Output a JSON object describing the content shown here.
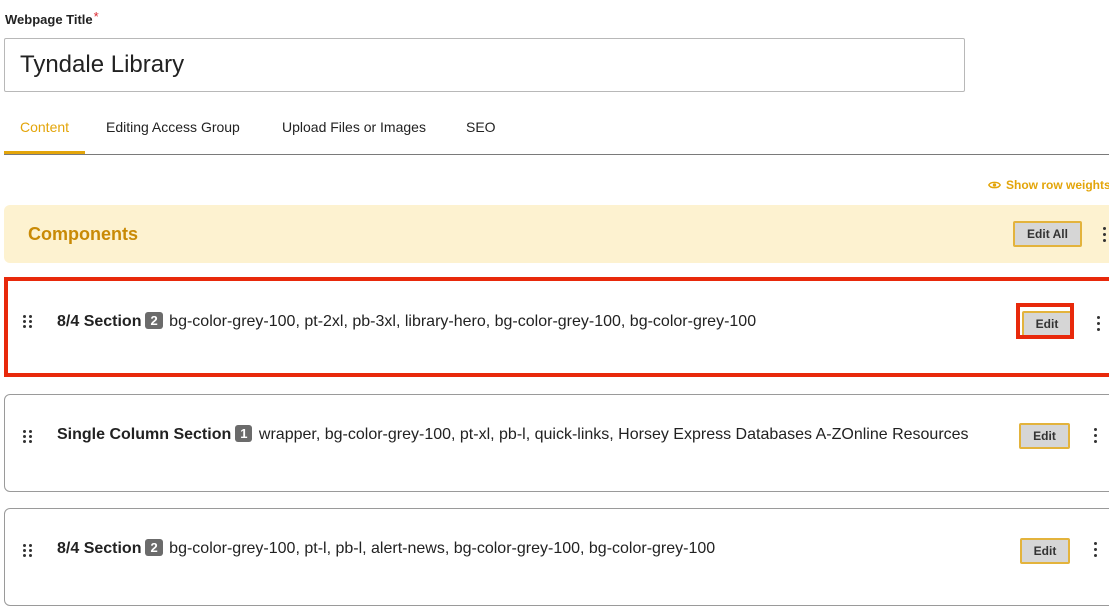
{
  "form": {
    "title_label": "Webpage Title",
    "required_mark": "*",
    "title_value": "Tyndale Library"
  },
  "tabs": [
    {
      "label": "Content",
      "active": true
    },
    {
      "label": "Editing Access Group",
      "active": false
    },
    {
      "label": "Upload Files or Images",
      "active": false
    },
    {
      "label": "SEO",
      "active": false
    }
  ],
  "row_weights": {
    "label": "Show row weights",
    "icon": "eye-icon"
  },
  "components": {
    "title": "Components",
    "edit_all_label": "Edit All"
  },
  "sections": [
    {
      "name": "8/4 Section",
      "count": "2",
      "classes": "bg-color-grey-100, pt-2xl, pb-3xl, library-hero, bg-color-grey-100, bg-color-grey-100",
      "edit_label": "Edit",
      "highlighted": true
    },
    {
      "name": "Single Column Section",
      "count": "1",
      "classes": "wrapper, bg-color-grey-100, pt-xl, pb-l, quick-links, Horsey Express Databases A-ZOnline Resources",
      "edit_label": "Edit",
      "highlighted": false
    },
    {
      "name": "8/4 Section",
      "count": "2",
      "classes": "bg-color-grey-100, pt-l, pb-l, alert-news, bg-color-grey-100, bg-color-grey-100",
      "edit_label": "Edit",
      "highlighted": false
    }
  ],
  "colors": {
    "accent": "#e3a50a",
    "highlight": "#e8290b",
    "components_bg": "#fdf2d0",
    "components_title": "#c98a06"
  }
}
